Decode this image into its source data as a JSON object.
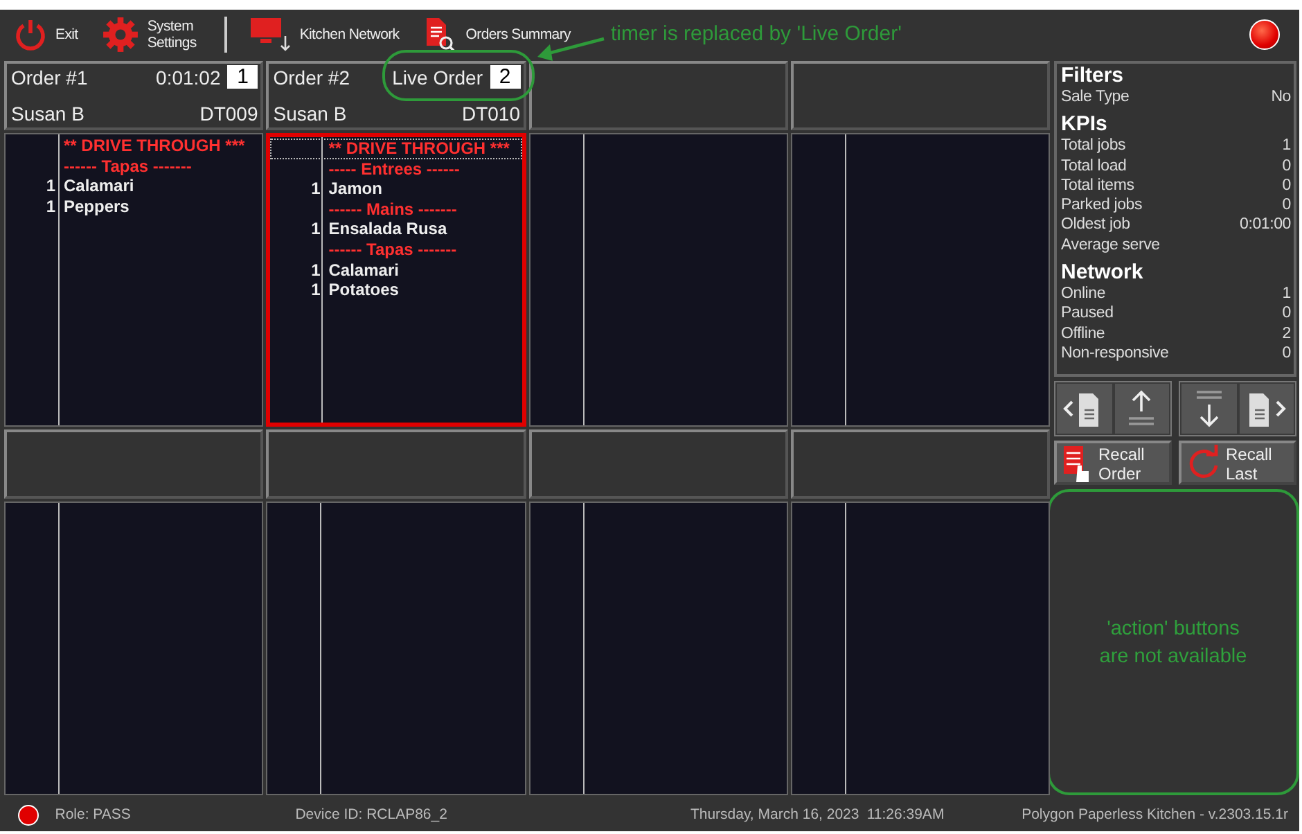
{
  "toolbar": {
    "buttons": [
      {
        "kind": "power",
        "label": "Exit"
      },
      {
        "kind": "gear",
        "label": "System Settings"
      },
      {
        "kind": "monitor",
        "label": "Kitchen Network"
      },
      {
        "kind": "document",
        "label": "Orders Summary"
      }
    ]
  },
  "callout": "timer is replaced by 'Live Order'",
  "orders": [
    {
      "kind": "order",
      "title": "Order #1",
      "timer": "0:01:02",
      "number": "1",
      "server": "Susan B",
      "table": "DT009",
      "selected": false,
      "lines": [
        {
          "kind": "header",
          "text": "** DRIVE THROUGH ***",
          "focused": false
        },
        {
          "kind": "course",
          "text": "------ Tapas -------"
        },
        {
          "kind": "item",
          "qty": "1",
          "text": "Calamari"
        },
        {
          "kind": "item",
          "qty": "1",
          "text": "Peppers"
        }
      ]
    },
    {
      "kind": "order",
      "title": "Order #2",
      "timer": "Live Order",
      "number": "2",
      "server": "Susan B",
      "table": "DT010",
      "selected": true,
      "lines": [
        {
          "kind": "header",
          "text": "** DRIVE THROUGH ***",
          "focused": true
        },
        {
          "kind": "course",
          "text": "----- Entrees ------"
        },
        {
          "kind": "item",
          "qty": "1",
          "text": "Jamon"
        },
        {
          "kind": "course",
          "text": "------ Mains -------"
        },
        {
          "kind": "item",
          "qty": "1",
          "text": "Ensalada Rusa"
        },
        {
          "kind": "course",
          "text": "------ Tapas -------"
        },
        {
          "kind": "item",
          "qty": "1",
          "text": "Calamari"
        },
        {
          "kind": "item",
          "qty": "1",
          "text": "Potatoes"
        }
      ]
    },
    {
      "kind": "empty"
    },
    {
      "kind": "empty"
    },
    {
      "kind": "empty"
    },
    {
      "kind": "empty"
    },
    {
      "kind": "empty"
    },
    {
      "kind": "empty"
    }
  ],
  "info_panel": [
    {
      "title": "Filters",
      "rows": [
        {
          "label": "Sale Type",
          "value": "No"
        }
      ]
    },
    {
      "title": "KPIs",
      "rows": [
        {
          "label": "Total jobs",
          "value": "1"
        },
        {
          "label": "Total load",
          "value": "0"
        },
        {
          "label": "Total items",
          "value": "0"
        },
        {
          "label": "Parked jobs",
          "value": "0"
        },
        {
          "label": "Oldest job",
          "value": "0:01:00"
        },
        {
          "label": "Average serve"
        }
      ]
    },
    {
      "title": "Network",
      "rows": [
        {
          "label": "Online",
          "value": "1"
        },
        {
          "label": "Paused",
          "value": "0"
        },
        {
          "label": "Offline",
          "value": "2"
        },
        {
          "label": "Non-responsive",
          "value": "0"
        }
      ]
    }
  ],
  "nav_buttons": [
    {
      "kind": "prev"
    },
    {
      "kind": "up"
    },
    {
      "kind": "down"
    },
    {
      "kind": "next"
    }
  ],
  "recall_buttons": [
    {
      "kind": "order",
      "label": "Recall Order"
    },
    {
      "kind": "last",
      "label": "Recall Last"
    }
  ],
  "annotation_box": "'action' buttons are not available",
  "status_bar": {
    "role": "Role: PASS",
    "device": "Device ID: RCLAP86_2",
    "date": "Thursday, March 16, 2023",
    "time": "11:26:39AM",
    "version": "Polygon Paperless Kitchen - v.2303.15.1r"
  }
}
